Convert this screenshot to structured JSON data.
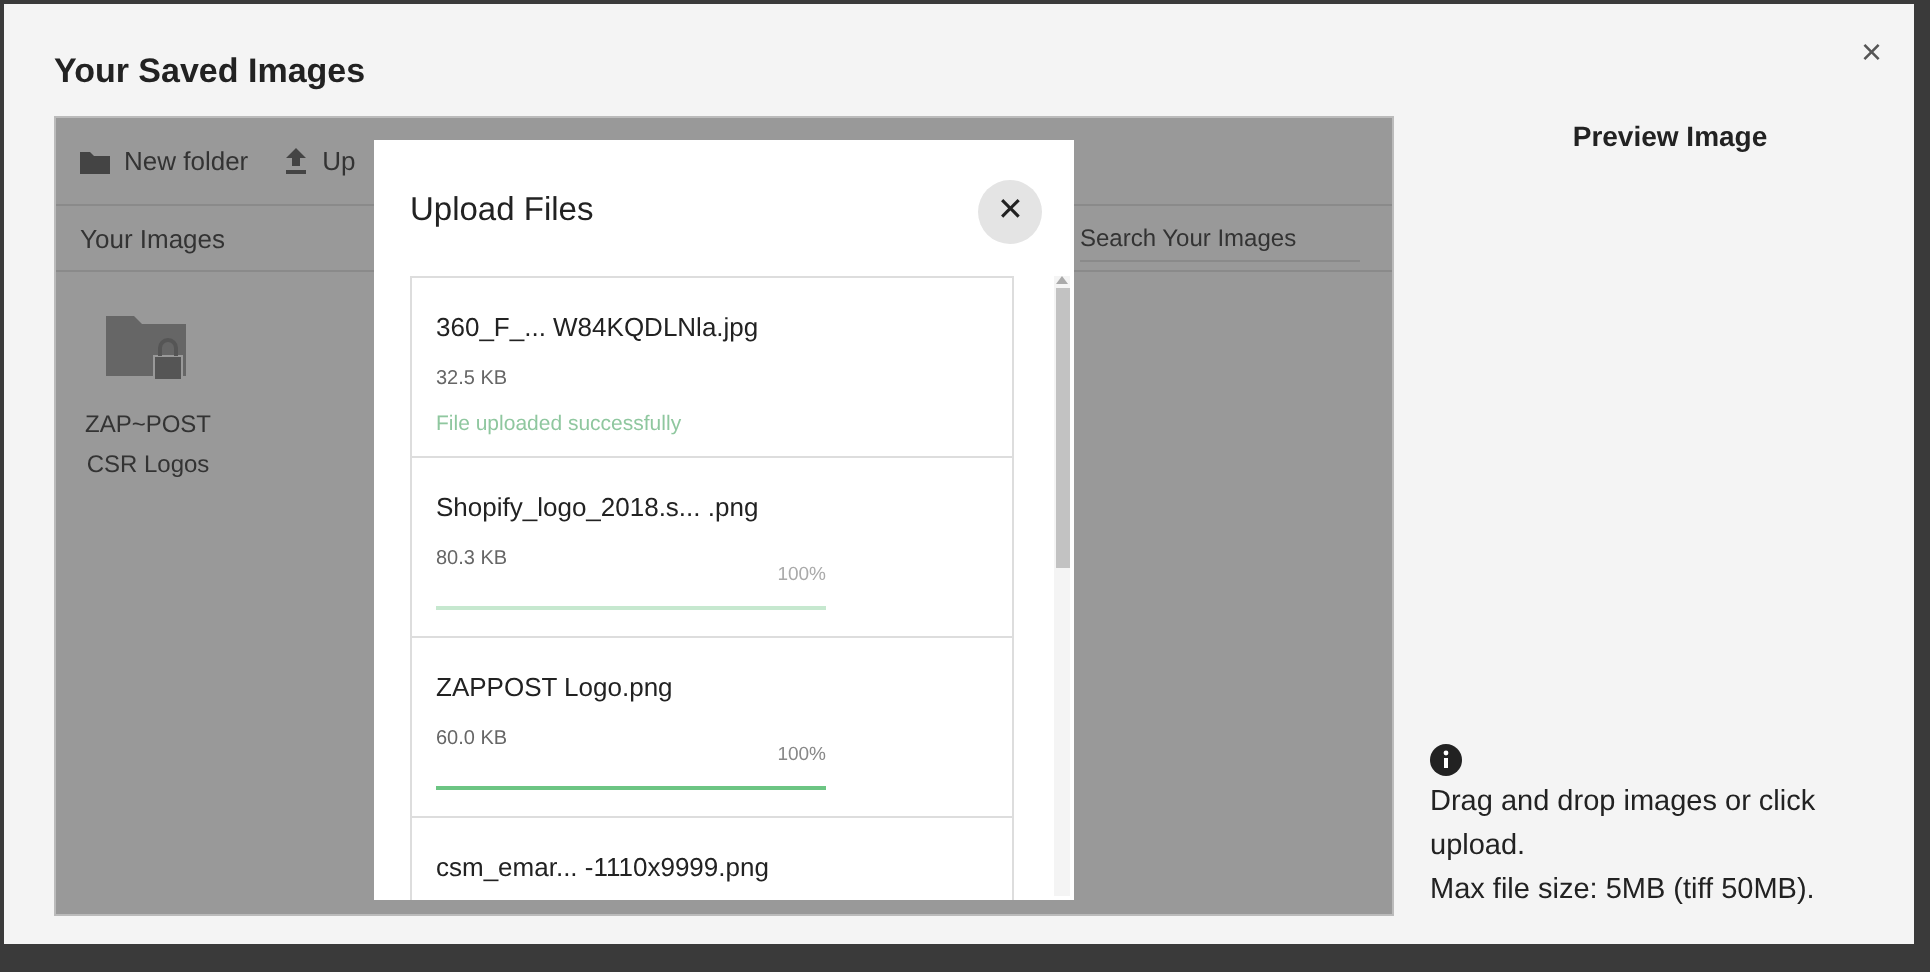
{
  "dialog": {
    "title": "Your Saved Images",
    "close": "×"
  },
  "toolbar": [
    {
      "label": "New folder"
    },
    {
      "label": "Up"
    }
  ],
  "images_header": "Your Images",
  "search": {
    "placeholder": "Search Your Images"
  },
  "folders": [
    {
      "name": "ZAP~POST CSR Logos",
      "locked": true
    }
  ],
  "preview": {
    "title": "Preview Image",
    "info": [
      "Drag and drop images or click upload.",
      "Max file size: 5MB (tiff 50MB)."
    ]
  },
  "upload_modal": {
    "title": "Upload Files",
    "close": "✕",
    "files": [
      {
        "name": "360_F_... W84KQDLNla.jpg",
        "size": "32.5 KB",
        "kind": "status",
        "status": "File uploaded successfully",
        "faded": true
      },
      {
        "name": "Shopify_logo_2018.s...  .png",
        "size": "80.3 KB",
        "kind": "progress",
        "level": 1,
        "percent": "100%",
        "faded": true
      },
      {
        "name": "ZAPPOST Logo.png",
        "size": "60.0 KB",
        "kind": "progress",
        "level": 1,
        "percent": "100%",
        "faded": false
      },
      {
        "name": "csm_emar... -1110x9999.png",
        "kind": "cut"
      }
    ]
  }
}
